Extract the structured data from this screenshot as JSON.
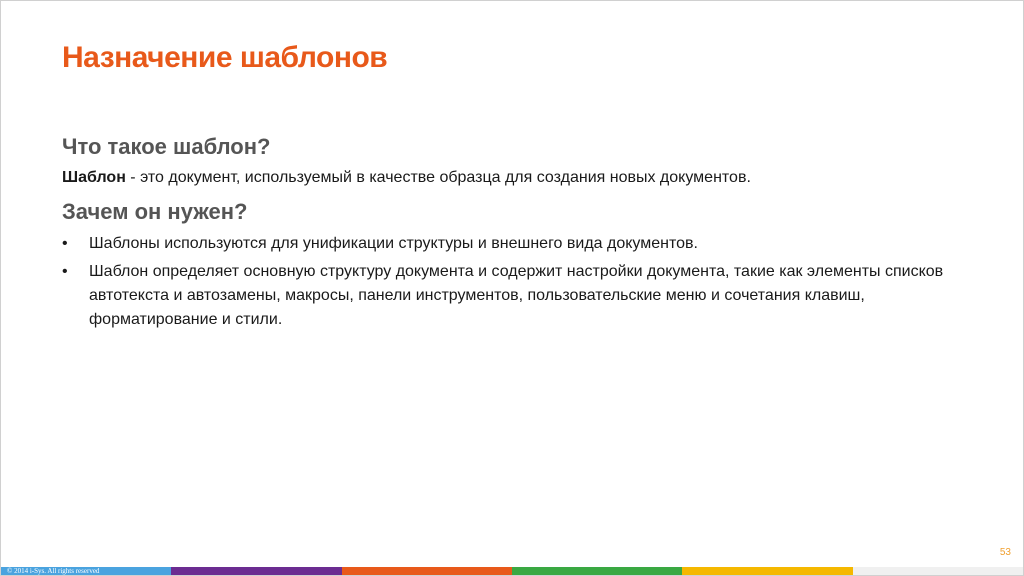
{
  "slide": {
    "title": "Назначение шаблонов",
    "section1": {
      "heading": "Что такое шаблон?",
      "term": "Шаблон",
      "definition": " - это документ, используемый в качестве образца для создания новых документов."
    },
    "section2": {
      "heading": "Зачем он нужен?",
      "bullet_symbol": "•",
      "bullets": [
        "Шаблоны используются для унификации структуры и внешнего вида документов.",
        "Шаблон определяет основную структуру документа и содержит настройки документа, такие как элементы списков автотекста и автозамены, макросы, панели инструментов, пользовательские меню и сочетания клавиш, форматирование и стили."
      ]
    },
    "page_number": "53",
    "copyright": "© 2014 i-Sys. All rights reserved"
  },
  "colors": {
    "title": "#e8591a",
    "heading": "#555555",
    "page_number": "#f0a030",
    "footer_segments": [
      "#4aa3df",
      "#6b2c91",
      "#e8591a",
      "#3aa842",
      "#f5b800",
      "#f0f0f0"
    ]
  }
}
